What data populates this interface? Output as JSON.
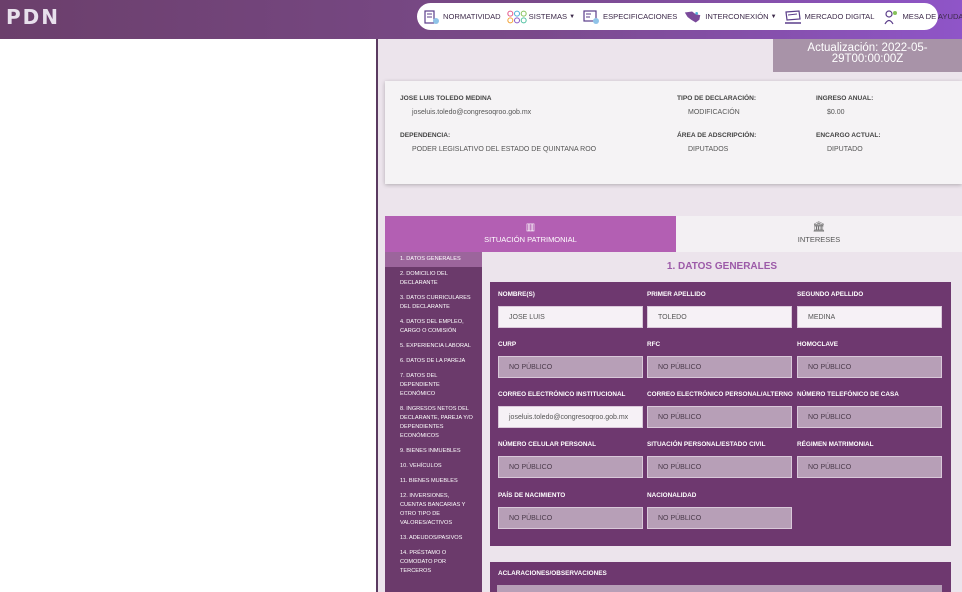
{
  "header": {
    "logo": "PDN",
    "nav": [
      {
        "label": "NORMATIVIDAD",
        "icon": "normatividad-icon",
        "has_dropdown": false
      },
      {
        "label": "SISTEMAS",
        "icon": "sistemas-circles-icon",
        "has_dropdown": true
      },
      {
        "label": "ESPECIFICACIONES",
        "icon": "especificaciones-icon",
        "has_dropdown": false
      },
      {
        "label": "INTERCONEXIÓN",
        "icon": "interconexion-map-icon",
        "has_dropdown": true
      },
      {
        "label": "MERCADO DIGITAL",
        "icon": "mercado-digital-icon",
        "has_dropdown": false
      },
      {
        "label": "MESA DE AYUDA",
        "icon": "mesa-ayuda-icon",
        "has_dropdown": false
      }
    ]
  },
  "update": {
    "text": "Actualización: 2022-05-29T00:00:00Z"
  },
  "declarant": {
    "name": "JOSE LUIS TOLEDO MEDINA",
    "email": "joseluis.toledo@congresoqroo.gob.mx",
    "tipo_label": "TIPO DE DECLARACIÓN:",
    "tipo_value": "MODIFICACIÓN",
    "ingreso_label": "INGRESO ANUAL:",
    "ingreso_value": "$0.00",
    "dependencia_label": "DEPENDENCIA:",
    "dependencia_value": "PODER LEGISLATIVO DEL ESTADO DE QUINTANA ROO",
    "area_label": "ÁREA DE ADSCRIPCIÓN:",
    "area_value": "DIPUTADOS",
    "encargo_label": "ENCARGO ACTUAL:",
    "encargo_value": "DIPUTADO"
  },
  "tabs": {
    "situacion": "SITUACIÓN PATRIMONIAL",
    "intereses": "INTERESES"
  },
  "sidebar": [
    "1. DATOS GENERALES",
    "2. DOMICILIO DEL DECLARANTE",
    "3. DATOS CURRICULARES DEL DECLARANTE",
    "4. DATOS DEL EMPLEO, CARGO O COMISIÓN",
    "5. EXPERIENCIA LABORAL",
    "6. DATOS DE LA PAREJA",
    "7. DATOS DEL DEPENDIENTE ECONÓMICO",
    "8. INGRESOS NETOS DEL DECLARANTE, PAREJA Y/O DEPENDIENTES ECONÓMICOS",
    "9. BIENES INMUEBLES",
    "10. VEHÍCULOS",
    "11. BIENES MUEBLES",
    "12. INVERSIONES, CUENTAS BANCARIAS Y OTRO TIPO DE VALORES/ACTIVOS",
    "13. ADEUDOS/PASIVOS",
    "14. PRÉSTAMO O COMODATO POR TERCEROS"
  ],
  "section": {
    "title": "1. DATOS GENERALES",
    "fields": [
      {
        "label": "NOMBRE(S)",
        "value": "JOSE LUIS",
        "style": "white"
      },
      {
        "label": "PRIMER APELLIDO",
        "value": "TOLEDO",
        "style": "white"
      },
      {
        "label": "SEGUNDO APELLIDO",
        "value": "MEDINA",
        "style": "white"
      },
      {
        "label": "CURP",
        "value": "NO PÚBLICO",
        "style": "grey"
      },
      {
        "label": "RFC",
        "value": "NO PÚBLICO",
        "style": "grey"
      },
      {
        "label": "HOMOCLAVE",
        "value": "NO PÚBLICO",
        "style": "grey"
      },
      {
        "label": "CORREO ELECTRÓNICO INSTITUCIONAL",
        "value": "joseluis.toledo@congresoqroo.gob.mx",
        "style": "white"
      },
      {
        "label": "CORREO ELECTRÓNICO PERSONAL/ALTERNO",
        "value": "NO PÚBLICO",
        "style": "grey"
      },
      {
        "label": "NÚMERO TELEFÓNICO DE CASA",
        "value": "NO PÚBLICO",
        "style": "grey"
      },
      {
        "label": "NÚMERO CELULAR PERSONAL",
        "value": "NO PÚBLICO",
        "style": "grey"
      },
      {
        "label": "SITUACIÓN PERSONAL/ESTADO CIVIL",
        "value": "NO PÚBLICO",
        "style": "grey"
      },
      {
        "label": "RÉGIMEN MATRIMONIAL",
        "value": "NO PÚBLICO",
        "style": "grey"
      },
      {
        "label": "PAÍS DE NACIMIENTO",
        "value": "NO PÚBLICO",
        "style": "grey"
      },
      {
        "label": "NACIONALIDAD",
        "value": "NO PÚBLICO",
        "style": "grey"
      }
    ],
    "observaciones_label": "ACLARACIONES/OBSERVACIONES"
  },
  "colors": {
    "header_start": "#6b3f6b",
    "header_end": "#8f55c8",
    "tab_active": "#b35fb3",
    "sidebar": "#6b3a6b",
    "form_card": "#6e386f",
    "title_accent": "#9c5aa8"
  }
}
